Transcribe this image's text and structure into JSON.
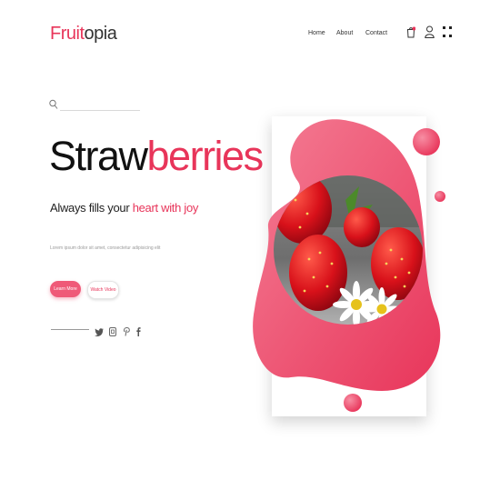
{
  "brand": {
    "logo_part1": "Fruit",
    "logo_part2": "opia"
  },
  "nav": {
    "items": [
      "Home",
      "About",
      "Contact"
    ]
  },
  "header_icons": [
    "bag-icon",
    "user-icon",
    "grid-menu-icon"
  ],
  "search": {
    "placeholder": ""
  },
  "hero": {
    "title_part1": "Straw",
    "title_part2": "berries",
    "subtitle_part1": "Always fills your ",
    "subtitle_part2": "heart with joy",
    "body": "Lorem ipsum dolor sit amet, consectetur adipisicing elit"
  },
  "buttons": {
    "primary": "Learn More",
    "secondary": "Watch Video"
  },
  "social_icons": [
    "twitter-icon",
    "instagram-icon",
    "pinterest-icon",
    "facebook-icon"
  ],
  "colors": {
    "accent": "#e8355a",
    "accent_light": "#f0607c",
    "text": "#222222"
  }
}
